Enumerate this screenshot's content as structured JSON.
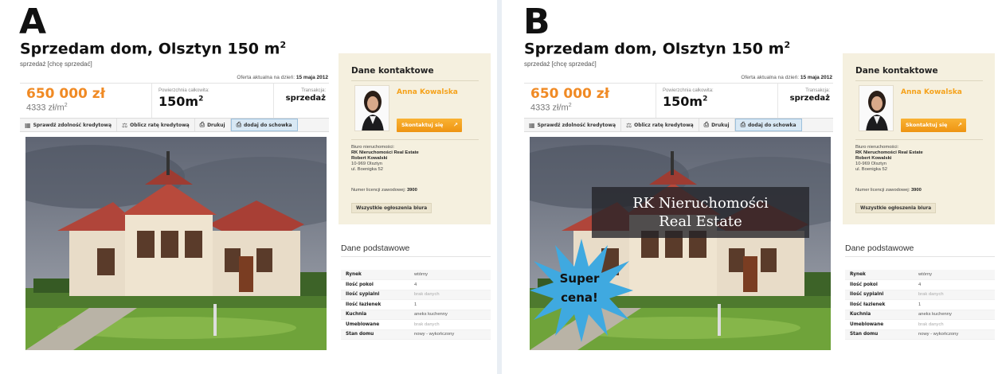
{
  "panels": [
    {
      "letter": "A",
      "title": "Sprzedam dom, Olsztyn 150 m",
      "title_sup": "2",
      "subtitle": "sprzedaż [chcę sprzedać]",
      "offer_date_label": "Oferta aktualna na dzień:",
      "offer_date": "15 maja 2012",
      "price": "650 000 zł",
      "price_per_m2": "4333 zł/m",
      "price_per_m2_sup": "2",
      "area_label": "Powierzchnia całkowita:",
      "area_value": "150m",
      "area_sup": "2",
      "transaction_label": "Transakcja:",
      "transaction_value": "sprzedaż",
      "toolbar": {
        "credit_check": "Sprawdź zdolność kredytową",
        "calc_rate": "Oblicz ratę kredytową",
        "print": "Drukuj",
        "clipboard": "dodaj do schowka"
      },
      "contact": {
        "title": "Dane kontaktowe",
        "agent_name": "Anna Kowalska",
        "contact_button": "Skontaktuj się",
        "agency_label": "Biuro nieruchomości:",
        "agency_name": "RK Nieruchomości Real Estate",
        "agency_person": "Robert Kowalski",
        "agency_postcode": "10-969 Olsztyn",
        "agency_street": "ul. Boenigka 52",
        "license_label": "Numer licencji zawodowej:",
        "license_number": "3900",
        "all_offers_button": "Wszystkie ogłoszenia biura"
      },
      "basic": {
        "title": "Dane podstawowe",
        "rows": [
          {
            "key": "Rynek",
            "value": "wtórny"
          },
          {
            "key": "Ilość pokoi",
            "value": "4"
          },
          {
            "key": "Ilość sypialni",
            "value": "brak danych"
          },
          {
            "key": "Ilość łazienek",
            "value": "1"
          },
          {
            "key": "Kuchnia",
            "value": "aneks kuchenny"
          },
          {
            "key": "Umeblowane",
            "value": "brak danych"
          },
          {
            "key": "Stan domu",
            "value": "nowy - wykończony"
          }
        ]
      }
    },
    {
      "letter": "B",
      "title": "Sprzedam dom, Olsztyn 150 m",
      "title_sup": "2",
      "subtitle": "sprzedaż [chcę sprzedać]",
      "offer_date_label": "Oferta aktualna na dzień:",
      "offer_date": "15 maja 2012",
      "price": "650 000 zł",
      "price_per_m2": "4333 zł/m",
      "price_per_m2_sup": "2",
      "area_label": "Powierzchnia całkowita:",
      "area_value": "150m",
      "area_sup": "2",
      "transaction_label": "Transakcja:",
      "transaction_value": "sprzedaż",
      "toolbar": {
        "credit_check": "Sprawdź zdolność kredytową",
        "calc_rate": "Oblicz ratę kredytową",
        "print": "Drukuj",
        "clipboard": "dodaj do schowka"
      },
      "overlay": {
        "banner_line1": "RK Nieruchomości",
        "banner_line2": "Real Estate",
        "burst_line1": "Super",
        "burst_line2": "cena!"
      },
      "contact": {
        "title": "Dane kontaktowe",
        "agent_name": "Anna Kowalska",
        "contact_button": "Skontaktuj się",
        "agency_label": "Biuro nieruchomości:",
        "agency_name": "RK Nieruchomości Real Estate",
        "agency_person": "Robert Kowalski",
        "agency_postcode": "10-969 Olsztyn",
        "agency_street": "ul. Boenigka 52",
        "license_label": "Numer licencji zawodowej:",
        "license_number": "3900",
        "all_offers_button": "Wszystkie ogłoszenia biura"
      },
      "basic": {
        "title": "Dane podstawowe",
        "rows": [
          {
            "key": "Rynek",
            "value": "wtórny"
          },
          {
            "key": "Ilość pokoi",
            "value": "4"
          },
          {
            "key": "Ilość sypialni",
            "value": "brak danych"
          },
          {
            "key": "Ilość łazienek",
            "value": "1"
          },
          {
            "key": "Kuchnia",
            "value": "aneks kuchenny"
          },
          {
            "key": "Umeblowane",
            "value": "brak danych"
          },
          {
            "key": "Stan domu",
            "value": "nowy - wykończony"
          }
        ]
      }
    }
  ],
  "colors": {
    "accent_orange": "#f08a24",
    "contact_bg": "#f5f0df",
    "burst_blue": "#3fa9e0"
  },
  "icons": {
    "credit_check": "calculator-icon",
    "calc_rate": "scale-icon",
    "print": "printer-icon",
    "clipboard": "clipboard-icon",
    "contact_arrow": "arrow-icon"
  }
}
